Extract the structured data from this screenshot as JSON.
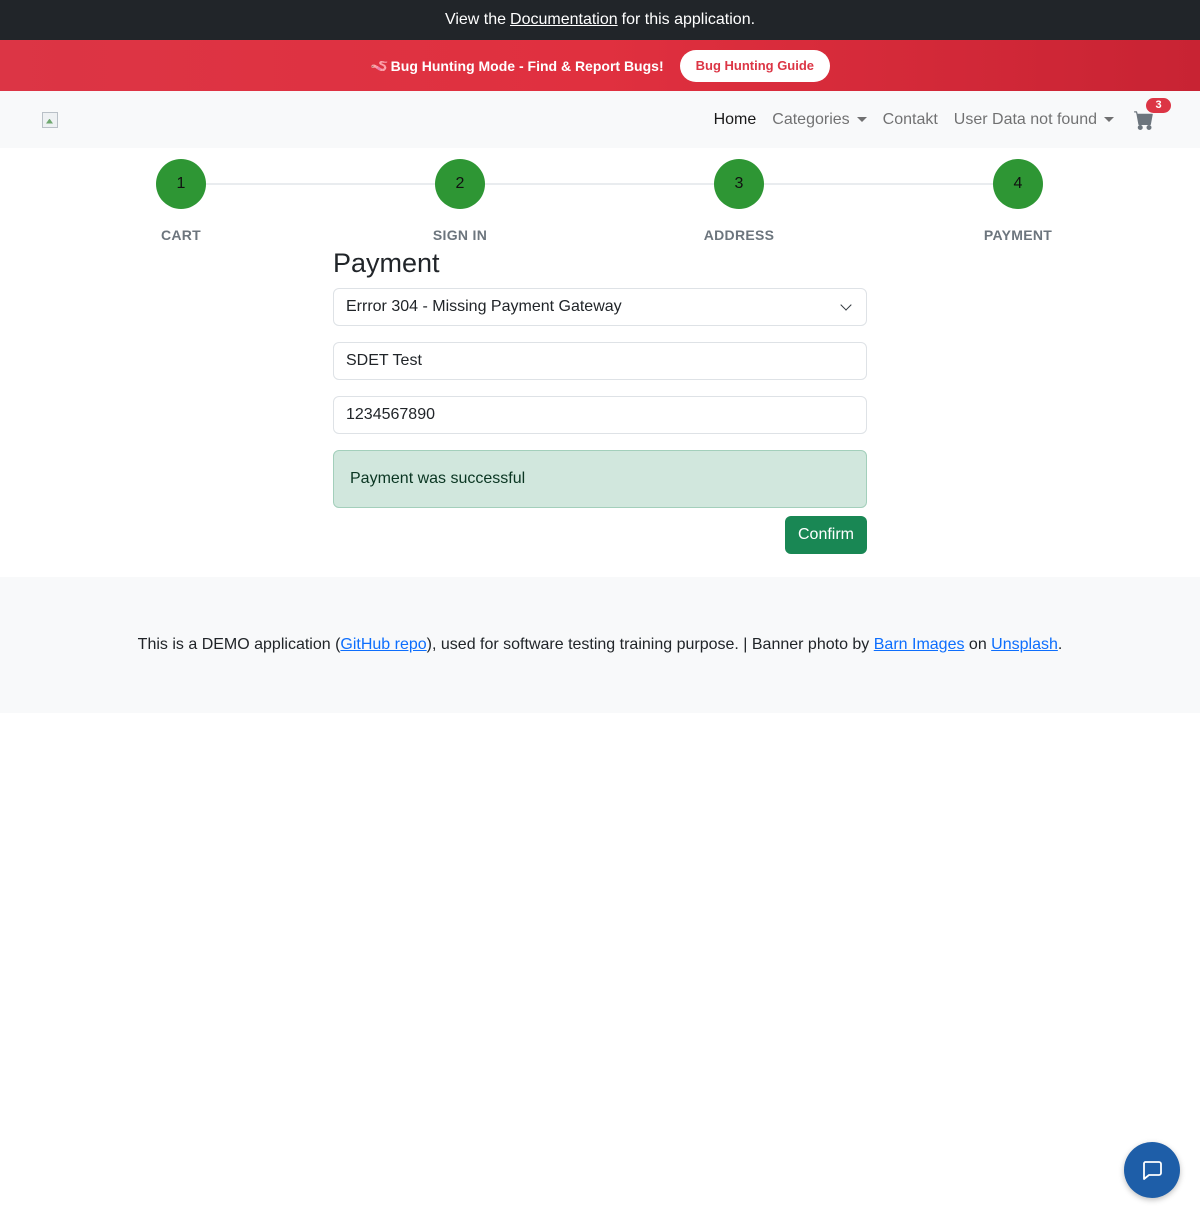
{
  "doc_bar": {
    "prefix": "View the",
    "link": "Documentation",
    "suffix": "for this application."
  },
  "bug_bar": {
    "icon": "🪱",
    "text": "Bug Hunting Mode - Find & Report Bugs!",
    "button": "Bug Hunting Guide"
  },
  "navbar": {
    "logo": "logo-image",
    "links": {
      "home": "Home",
      "categories": "Categories",
      "contact": "Contakt",
      "user": "User Data not found"
    },
    "cart_count": "3"
  },
  "steps": [
    {
      "number": "1",
      "label": "CART"
    },
    {
      "number": "2",
      "label": "SIGN IN"
    },
    {
      "number": "3",
      "label": "ADDRESS"
    },
    {
      "number": "4",
      "label": "PAYMENT"
    }
  ],
  "payment": {
    "title": "Payment",
    "gateway_selected": "Errror 304 - Missing Payment Gateway",
    "name_value": "SDET Test",
    "number_value": "1234567890",
    "alert": "Payment was successful",
    "confirm": "Confirm"
  },
  "footer": {
    "text1": "This is a DEMO application (",
    "link_github": "GitHub repo",
    "text2": "), used for software testing training purpose. | Banner photo by ",
    "link_barn": "Barn Images",
    "text3": " on ",
    "link_unsplash": "Unsplash",
    "text4": "."
  },
  "colors": {
    "step_green": "#2e9634",
    "confirm_green": "#198754",
    "banner_red": "#dc3545",
    "chat_blue": "#1e5ea8"
  }
}
